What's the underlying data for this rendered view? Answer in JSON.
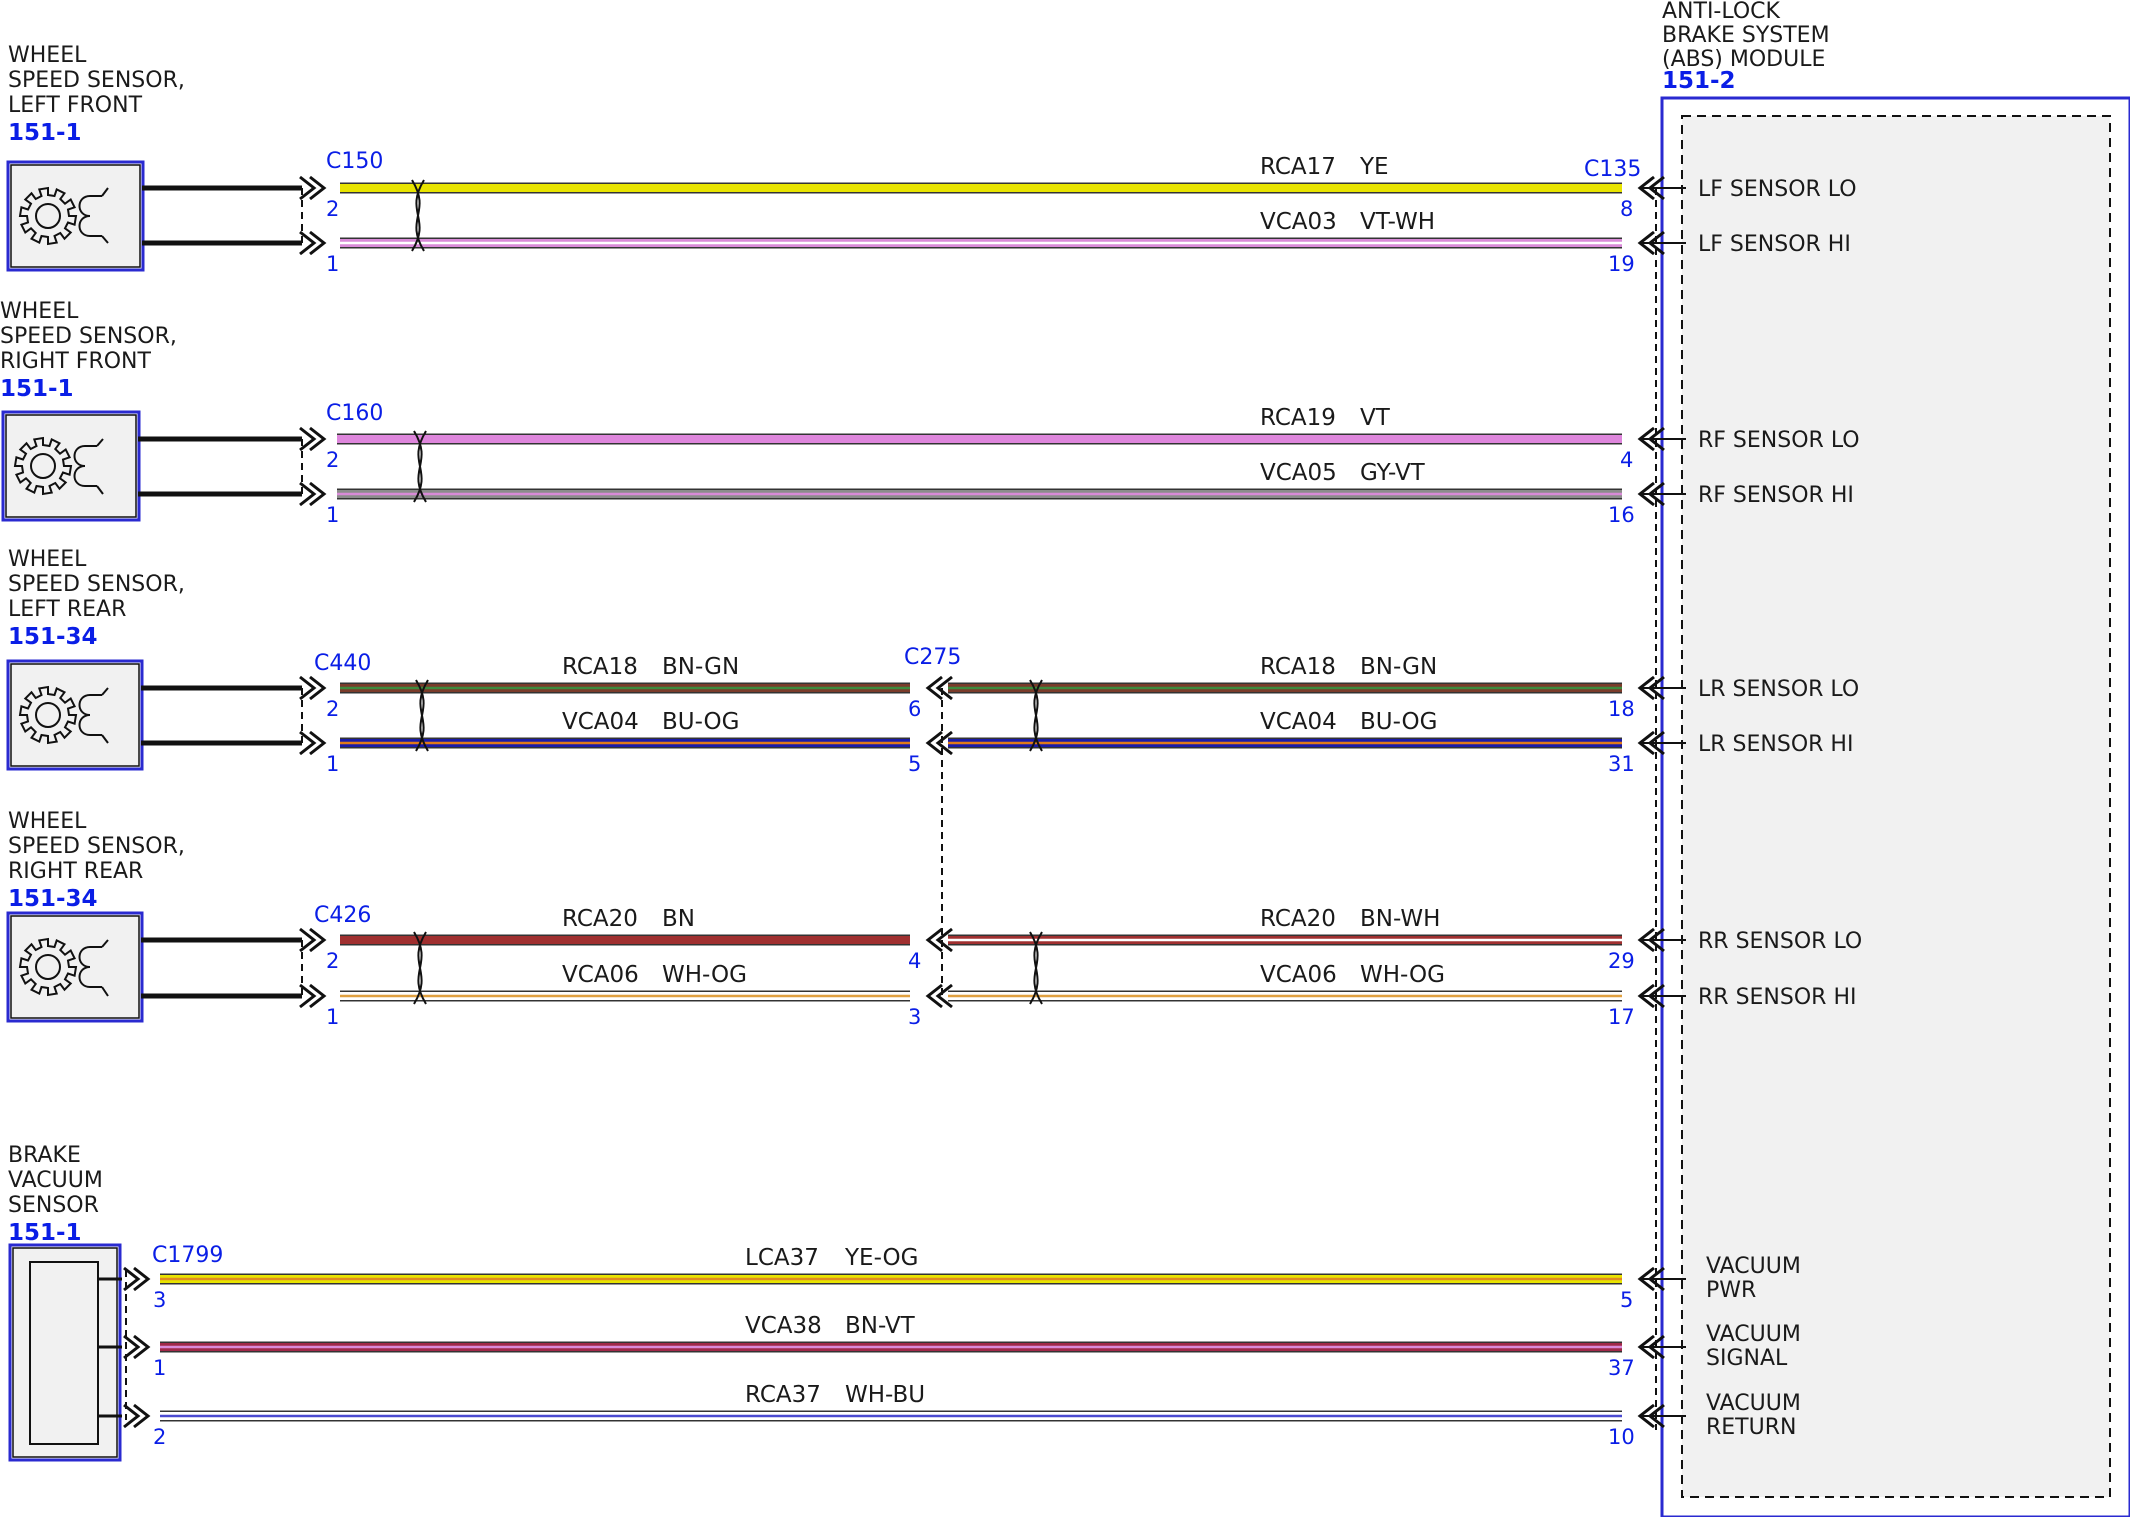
{
  "module": {
    "title_lines": [
      "ANTI-LOCK",
      "BRAKE SYSTEM",
      "(ABS) MODULE"
    ],
    "ref": "151-2",
    "connector": "C135"
  },
  "sensors": [
    {
      "id": "lf",
      "title_lines": [
        "WHEEL",
        "SPEED SENSOR,",
        "LEFT FRONT"
      ],
      "ref": "151-1",
      "connector": "C150"
    },
    {
      "id": "rf",
      "title_lines": [
        "WHEEL",
        "SPEED SENSOR,",
        "RIGHT FRONT"
      ],
      "ref": "151-1",
      "connector": "C160"
    },
    {
      "id": "lr",
      "title_lines": [
        "WHEEL",
        "SPEED SENSOR,",
        "LEFT REAR"
      ],
      "ref": "151-34",
      "connector": "C440"
    },
    {
      "id": "rr",
      "title_lines": [
        "WHEEL",
        "SPEED SENSOR,",
        "RIGHT REAR"
      ],
      "ref": "151-34",
      "connector": "C426"
    },
    {
      "id": "vac",
      "title_lines": [
        "BRAKE",
        "VACUUM",
        "SENSOR"
      ],
      "ref": "151-1",
      "connector": "C1799"
    }
  ],
  "inline_connector": "C275",
  "wires": [
    {
      "group": "lf",
      "seg": "full",
      "circuit": "RCA17",
      "color_code": "YE",
      "start_pin": "2",
      "end_pin": "8",
      "module_label": [
        "LF SENSOR LO"
      ],
      "colors": [
        "#e8e400"
      ]
    },
    {
      "group": "lf",
      "seg": "full",
      "circuit": "VCA03",
      "color_code": "VT-WH",
      "start_pin": "1",
      "end_pin": "19",
      "module_label": [
        "LF SENSOR HI"
      ],
      "colors": [
        "#d98ad8",
        "#ffffff"
      ]
    },
    {
      "group": "rf",
      "seg": "full",
      "circuit": "RCA19",
      "color_code": "VT",
      "start_pin": "2",
      "end_pin": "4",
      "module_label": [
        "RF SENSOR LO"
      ],
      "colors": [
        "#de86dc"
      ]
    },
    {
      "group": "rf",
      "seg": "full",
      "circuit": "VCA05",
      "color_code": "GY-VT",
      "start_pin": "1",
      "end_pin": "16",
      "module_label": [
        "RF SENSOR HI"
      ],
      "colors": [
        "#8c8c8c",
        "#d98ad8"
      ]
    },
    {
      "group": "lr",
      "seg": "left",
      "circuit": "RCA18",
      "color_code": "BN-GN",
      "start_pin": "2",
      "end_pin": "6",
      "colors": [
        "#7a3b2a",
        "#3d8a3d"
      ]
    },
    {
      "group": "lr",
      "seg": "left",
      "circuit": "VCA04",
      "color_code": "BU-OG",
      "start_pin": "1",
      "end_pin": "5",
      "colors": [
        "#1a1aa8",
        "#e07a1a"
      ]
    },
    {
      "group": "lr",
      "seg": "right",
      "circuit": "RCA18",
      "color_code": "BN-GN",
      "start_pin": "6",
      "end_pin": "18",
      "module_label": [
        "LR SENSOR LO"
      ],
      "colors": [
        "#7a3b2a",
        "#3d8a3d"
      ]
    },
    {
      "group": "lr",
      "seg": "right",
      "circuit": "VCA04",
      "color_code": "BU-OG",
      "start_pin": "5",
      "end_pin": "31",
      "module_label": [
        "LR SENSOR HI"
      ],
      "colors": [
        "#1a1aa8",
        "#e07a1a"
      ]
    },
    {
      "group": "rr",
      "seg": "left",
      "circuit": "RCA20",
      "color_code": "BN",
      "start_pin": "2",
      "end_pin": "4",
      "colors": [
        "#a03030"
      ]
    },
    {
      "group": "rr",
      "seg": "left",
      "circuit": "VCA06",
      "color_code": "WH-OG",
      "start_pin": "1",
      "end_pin": "3",
      "colors": [
        "#ffffff",
        "#e0a040"
      ]
    },
    {
      "group": "rr",
      "seg": "right",
      "circuit": "RCA20",
      "color_code": "BN-WH",
      "start_pin": "4",
      "end_pin": "29",
      "module_label": [
        "RR SENSOR LO"
      ],
      "colors": [
        "#a03030",
        "#ffffff"
      ]
    },
    {
      "group": "rr",
      "seg": "right",
      "circuit": "VCA06",
      "color_code": "WH-OG",
      "start_pin": "3",
      "end_pin": "17",
      "module_label": [
        "RR SENSOR HI"
      ],
      "colors": [
        "#ffffff",
        "#e0a040"
      ]
    },
    {
      "group": "vac",
      "seg": "full",
      "circuit": "LCA37",
      "color_code": "YE-OG",
      "start_pin": "3",
      "end_pin": "5",
      "module_label": [
        "VACUUM",
        "PWR"
      ],
      "colors": [
        "#e8e400",
        "#e08a20"
      ]
    },
    {
      "group": "vac",
      "seg": "full",
      "circuit": "VCA38",
      "color_code": "BN-VT",
      "start_pin": "1",
      "end_pin": "37",
      "module_label": [
        "VACUUM",
        "SIGNAL"
      ],
      "colors": [
        "#a02848",
        "#d98ad8"
      ]
    },
    {
      "group": "vac",
      "seg": "full",
      "circuit": "RCA37",
      "color_code": "WH-BU",
      "start_pin": "2",
      "end_pin": "10",
      "module_label": [
        "VACUUM",
        "RETURN"
      ],
      "colors": [
        "#ffffff",
        "#4a4ad0"
      ]
    }
  ]
}
